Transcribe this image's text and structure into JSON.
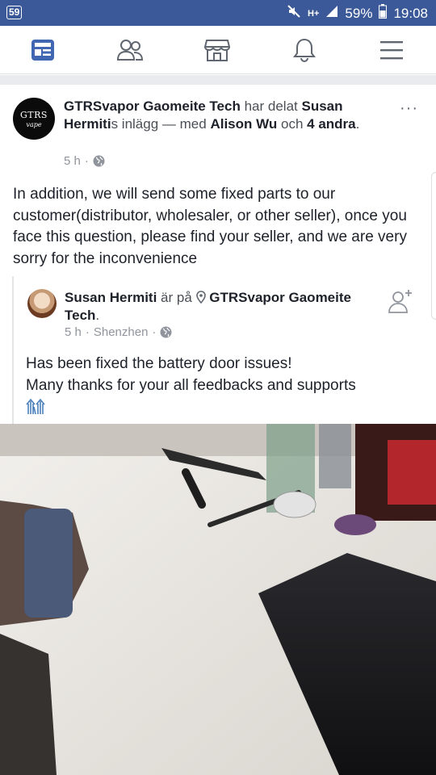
{
  "status_bar": {
    "notification_badge": "59",
    "network": "H+",
    "battery": "59%",
    "time": "19:08"
  },
  "nav": {
    "items": [
      {
        "name": "news-feed",
        "icon": "news-feed-icon",
        "active": true
      },
      {
        "name": "friends",
        "icon": "friends-icon",
        "active": false
      },
      {
        "name": "marketplace",
        "icon": "marketplace-icon",
        "active": false
      },
      {
        "name": "notifications",
        "icon": "bell-icon",
        "active": false
      },
      {
        "name": "menu",
        "icon": "hamburger-icon",
        "active": false
      }
    ],
    "active_color": "#4267b2",
    "inactive_color": "#606770"
  },
  "post": {
    "avatar_text_top": "GTRS",
    "avatar_text_bottom": "vape",
    "author": "GTRSvapor Gaomeite Tech",
    "verb": "har delat",
    "shared_from": "Susan Hermiti",
    "shared_suffix": "s inlägg",
    "with": "— med",
    "tagged": "Alison Wu",
    "and": "och",
    "others": "4 andra",
    "period": ".",
    "time": "5 h",
    "more_label": "···",
    "body": "In addition, we will send some fixed parts to our customer(distributor, wholesaler, or other seller), once you face this question, please find your seller, and we are very sorry for the inconvenience"
  },
  "shared_post": {
    "author": "Susan Hermiti",
    "verb": "är på",
    "place": "GTRSvapor Gaomeite Tech",
    "period": ".",
    "time": "5 h",
    "location": "Shenzhen",
    "body_line1": "Has been fixed the battery door issues!",
    "body_line2": "Many thanks for your all feedbacks and supports"
  }
}
